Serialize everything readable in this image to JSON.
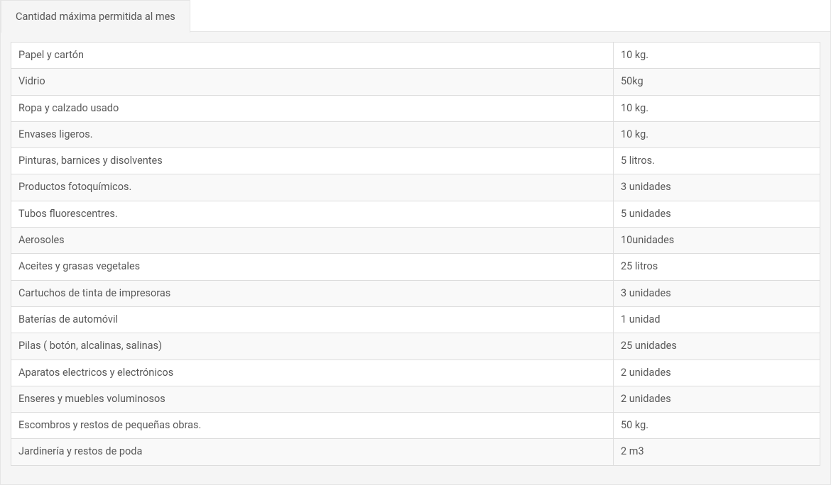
{
  "tab": {
    "label": "Cantidad máxima permitida al mes"
  },
  "rows": [
    {
      "name": "Papel y cartón",
      "limit": "10 kg."
    },
    {
      "name": "Vidrio",
      "limit": "50kg"
    },
    {
      "name": "Ropa y calzado usado",
      "limit": "10 kg."
    },
    {
      "name": "Envases ligeros.",
      "limit": "10 kg."
    },
    {
      "name": "Pinturas, barnices y disolventes",
      "limit": "5 litros."
    },
    {
      "name": "Productos fotoquímicos.",
      "limit": "3 unidades"
    },
    {
      "name": "Tubos fluorescentres.",
      "limit": "5 unidades"
    },
    {
      "name": "Aerosoles",
      "limit": "10unidades"
    },
    {
      "name": "Aceites y grasas vegetales",
      "limit": "25 litros"
    },
    {
      "name": "Cartuchos de tinta de impresoras",
      "limit": "3 unidades"
    },
    {
      "name": "Baterías de automóvil",
      "limit": "1 unidad"
    },
    {
      "name": "Pilas ( botón, alcalinas, salinas)",
      "limit": "25 unidades"
    },
    {
      "name": "Aparatos electricos y electrónicos",
      "limit": "2 unidades"
    },
    {
      "name": "Enseres y muebles voluminosos",
      "limit": "2 unidades"
    },
    {
      "name": "Escombros y restos de pequeñas obras.",
      "limit": "50 kg."
    },
    {
      "name": "Jardinería y restos de poda",
      "limit": "2 m3"
    }
  ]
}
